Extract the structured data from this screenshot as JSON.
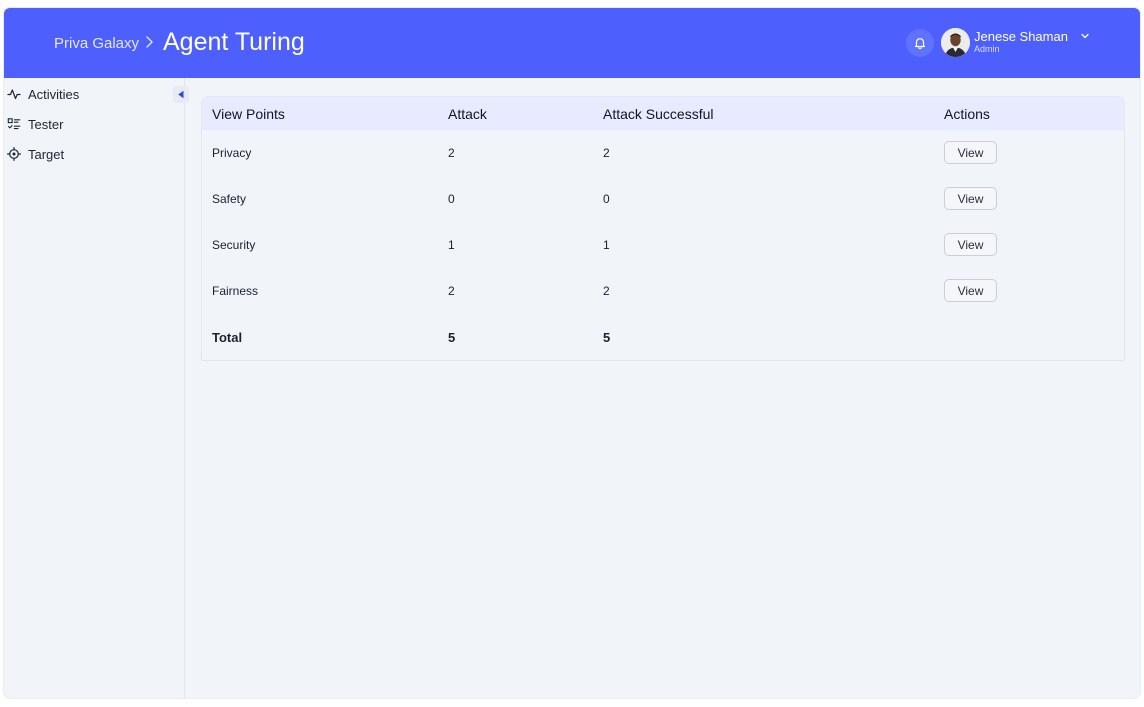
{
  "header": {
    "breadcrumb_parent": "Priva Galaxy",
    "title": "Agent Turing",
    "user": {
      "name": "Jenese Shaman",
      "role": "Admin"
    }
  },
  "sidebar": {
    "items": [
      {
        "label": "Activities",
        "icon": "activity-icon"
      },
      {
        "label": "Tester",
        "icon": "checklist-icon"
      },
      {
        "label": "Target",
        "icon": "target-icon"
      }
    ]
  },
  "table": {
    "columns": [
      "View Points",
      "Attack",
      "Attack Successful",
      "Actions"
    ],
    "rows": [
      {
        "view_point": "Privacy",
        "attack": "2",
        "attack_successful": "2",
        "action": "View"
      },
      {
        "view_point": "Safety",
        "attack": "0",
        "attack_successful": "0",
        "action": "View"
      },
      {
        "view_point": "Security",
        "attack": "1",
        "attack_successful": "1",
        "action": "View"
      },
      {
        "view_point": "Fairness",
        "attack": "2",
        "attack_successful": "2",
        "action": "View"
      }
    ],
    "total": {
      "label": "Total",
      "attack": "5",
      "attack_successful": "5"
    }
  },
  "colors": {
    "header_bg": "#4d5ffd",
    "table_header_bg": "#e8eaff",
    "page_bg": "#f1f4f9"
  }
}
